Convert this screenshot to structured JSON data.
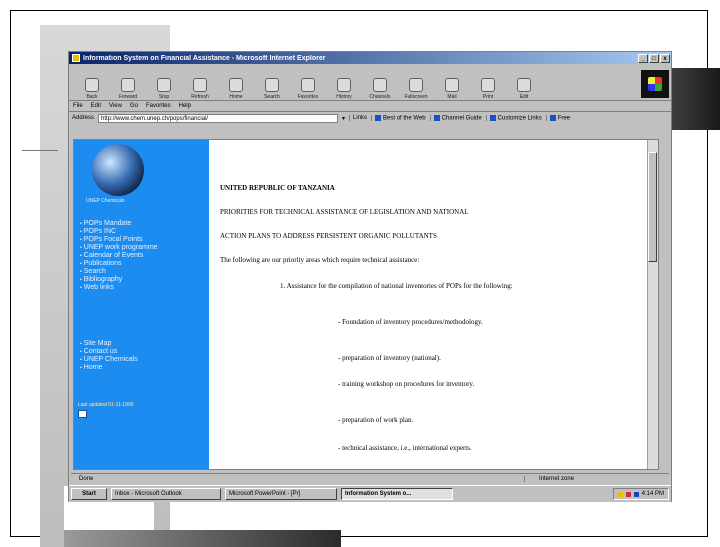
{
  "window": {
    "title": "Information System on Financial Assistance - Microsoft Internet Explorer",
    "controls": [
      "_",
      "□",
      "x"
    ]
  },
  "toolbar": [
    {
      "label": "Back",
      "icon": "back-icon"
    },
    {
      "label": "Forward",
      "icon": "forward-icon"
    },
    {
      "label": "Stop",
      "icon": "stop-icon"
    },
    {
      "label": "Refresh",
      "icon": "refresh-icon"
    },
    {
      "label": "Home",
      "icon": "home-icon"
    },
    {
      "label": "Search",
      "icon": "search-icon"
    },
    {
      "label": "Favorites",
      "icon": "favorites-icon"
    },
    {
      "label": "History",
      "icon": "history-icon"
    },
    {
      "label": "Channels",
      "icon": "channels-icon"
    },
    {
      "label": "Fullscreen",
      "icon": "fullscreen-icon"
    },
    {
      "label": "Mail",
      "icon": "mail-icon"
    },
    {
      "label": "Print",
      "icon": "print-icon"
    },
    {
      "label": "Edit",
      "icon": "edit-icon"
    }
  ],
  "menu": [
    "File",
    "Edit",
    "View",
    "Go",
    "Favorites",
    "Help"
  ],
  "address": {
    "label": "Address",
    "value": "http://www.chem.unep.ch/pops/financial/",
    "links_label": "Links",
    "links": [
      "Best of the Web",
      "Channel Guide",
      "Customize Links",
      "Free"
    ]
  },
  "sidebar": {
    "caption": "UNEP Chemicals",
    "nav_primary": [
      "POPs Mandate",
      "POPs INC",
      "POPs Focal Points",
      "UNEP work programme",
      "Calendar of Events",
      "Publications",
      "Search",
      "Bibliography",
      "Web links"
    ],
    "nav_secondary": [
      "Site Map",
      "Contact us",
      "UNEP Chemicals",
      "Home"
    ],
    "updated": "Last updated 01-11-1999"
  },
  "document": {
    "heading": "UNITED REPUBLIC OF TANZANIA",
    "line1": "PRIORITIES FOR TECHNICAL ASSISTANCE OF LEGISLATION AND NATIONAL",
    "line2": "ACTION PLANS TO ADDRESS PERSISTENT ORGANIC POLLUTANTS",
    "intro": "The following are our priority areas which require technical assistance:",
    "item1": "1. Assistance for the compilation of national inventories of POPs for the following:",
    "sub_items": [
      "- Foundation of inventory procedures/methodology.",
      "- preparation of inventory (national).",
      "- training workshop on procedures for inventory.",
      "- preparation of work plan.",
      "- technical assistance, i.e., international experts."
    ]
  },
  "status": {
    "left": "Done",
    "zone": "Internet zone"
  },
  "taskbar": {
    "start": "Start",
    "tasks": [
      "Inbox - Microsoft Outlook",
      "Microsoft PowerPoint - [Pr]",
      "Information System o..."
    ],
    "clock": "4:14 PM"
  }
}
